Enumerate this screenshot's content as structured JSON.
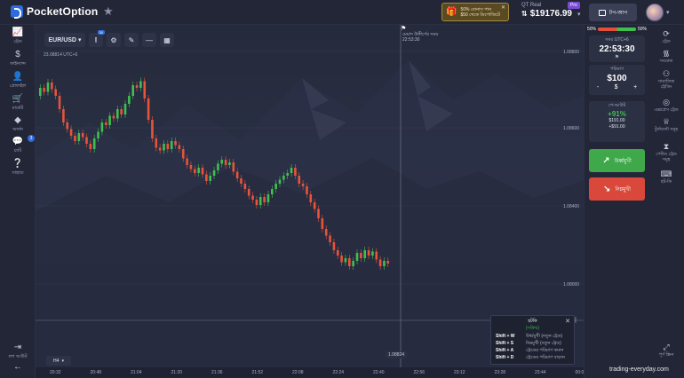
{
  "header": {
    "brand": "PocketOption",
    "promo": {
      "line1": "50% বোনাস পান",
      "line2": "$50 থেকে ডিপোজিটে"
    },
    "account": {
      "label": "QT Real",
      "balance": "$19176.99",
      "pro_badge": "Pro"
    },
    "topup_label": "টপ-আপ"
  },
  "left_nav": [
    {
      "icon": "chart-icon",
      "glyph": "📈",
      "label": "ট্রেড"
    },
    {
      "icon": "dollar-icon",
      "glyph": "$",
      "label": "ফাইন্যান্স"
    },
    {
      "icon": "profile-icon",
      "glyph": "👤",
      "label": "প্রোফাইল"
    },
    {
      "icon": "market-icon",
      "glyph": "🛒",
      "label": "মার্কেট"
    },
    {
      "icon": "diamond-icon",
      "glyph": "◆",
      "label": "অর্জন"
    },
    {
      "icon": "chat-icon",
      "glyph": "💬",
      "label": "চ্যাট",
      "badge": "3"
    },
    {
      "icon": "help-icon",
      "glyph": "?",
      "label": "সাহায্য"
    }
  ],
  "left_bottom": {
    "logout_label": "লগ আউট"
  },
  "chart_toolbar": {
    "pair": "EUR/USD",
    "indicator_badge": "30"
  },
  "chart_sub": "23.08814 UTC+6",
  "chart_overlay": {
    "expiry_label": "মেয়াদ উত্তীর্ণের সময়",
    "expiry_time": "22:53:30",
    "current_price_tag": "58",
    "price_marker": "1.08824",
    "timeframe": "H4"
  },
  "price_axis": [
    "1.08800",
    "1.08600",
    "1.08400",
    "1.08000"
  ],
  "time_axis": [
    "20:32",
    "20:48",
    "21:04",
    "21:20",
    "21:36",
    "21:52",
    "22:08",
    "22:24",
    "22:40",
    "22:56",
    "23:12",
    "23:28",
    "23:44",
    "00:00"
  ],
  "shortcuts": {
    "title": "হটকি",
    "subtitle": "(সক্রিয়)",
    "rows": [
      {
        "key": "Shift + W",
        "desc": "উর্ধ্বমুখী (নতুন ট্রেড)"
      },
      {
        "key": "Shift + S",
        "desc": "নিম্নমুখী (নতুন ট্রেড)"
      },
      {
        "key": "Shift + A",
        "desc": "ট্রেডের পরিমাণ কমান"
      },
      {
        "key": "Shift + D",
        "desc": "ট্রেডের পরিমাণ বাড়ান"
      }
    ]
  },
  "trade_panel": {
    "sentiment": {
      "sell": "50%",
      "buy": "50%",
      "buy_fraction": 0.5
    },
    "time_caption": "সময় UTC+6",
    "time_value": "22:53:30",
    "amount_caption": "পরিমাণ",
    "amount_value": "$100",
    "minus": "-",
    "currency": "$",
    "plus": "+",
    "payout_caption": "পে-আউট",
    "payout_pct": "+91%",
    "payout_amt": "$191.00",
    "profit_amt": "+$91.00",
    "buy_label": "উর্ধ্বমুখী",
    "sell_label": "নিম্নমুখী"
  },
  "right_nav": [
    {
      "icon": "trades-icon",
      "glyph": "⟳",
      "label": "ট্রেড"
    },
    {
      "icon": "signals-icon",
      "glyph": "📡",
      "label": "সংকেত"
    },
    {
      "icon": "social-icon",
      "glyph": "👥",
      "label": "সামাজিক ট্রেডিং"
    },
    {
      "icon": "express-icon",
      "glyph": "◎",
      "label": "এক্সপ্রেস ট্রেড"
    },
    {
      "icon": "tournament-icon",
      "glyph": "🏆",
      "label": "টুর্নামেন্ট সমূহ"
    },
    {
      "icon": "pending-icon",
      "glyph": "⧗",
      "label": "পেন্ডিং ট্রেড সমূহ"
    },
    {
      "icon": "hotkey-icon",
      "glyph": "⌨",
      "label": "হট-কি"
    },
    {
      "icon": "fullscreen-icon",
      "glyph": "⤢",
      "label": "পূর্ণ স্ক্রিন"
    }
  ],
  "watermark": "trading-everyday.com",
  "colors": {
    "up": "#3fbf4f",
    "down": "#e8533a",
    "accent": "#2d6cdf"
  },
  "chart_data": {
    "type": "candlestick",
    "series": [
      [
        0.8,
        0.86
      ],
      [
        0.86,
        0.83
      ],
      [
        0.83,
        0.9
      ],
      [
        0.9,
        0.85
      ],
      [
        0.85,
        0.8
      ],
      [
        0.8,
        0.7
      ],
      [
        0.7,
        0.6
      ],
      [
        0.6,
        0.55
      ],
      [
        0.55,
        0.5
      ],
      [
        0.5,
        0.46
      ],
      [
        0.46,
        0.52
      ],
      [
        0.52,
        0.49
      ],
      [
        0.49,
        0.44
      ],
      [
        0.44,
        0.4
      ],
      [
        0.4,
        0.48
      ],
      [
        0.48,
        0.53
      ],
      [
        0.53,
        0.6
      ],
      [
        0.6,
        0.58
      ],
      [
        0.58,
        0.65
      ],
      [
        0.65,
        0.63
      ],
      [
        0.63,
        0.7
      ],
      [
        0.7,
        0.66
      ],
      [
        0.66,
        0.74
      ],
      [
        0.74,
        0.8
      ],
      [
        0.8,
        0.88
      ],
      [
        0.88,
        0.86
      ],
      [
        0.86,
        0.91
      ],
      [
        0.91,
        0.78
      ],
      [
        0.78,
        0.62
      ],
      [
        0.62,
        0.48
      ],
      [
        0.48,
        0.41
      ],
      [
        0.41,
        0.39
      ],
      [
        0.39,
        0.44
      ],
      [
        0.44,
        0.4
      ],
      [
        0.4,
        0.46
      ],
      [
        0.46,
        0.43
      ],
      [
        0.43,
        0.4
      ],
      [
        0.4,
        0.33
      ],
      [
        0.33,
        0.28
      ],
      [
        0.28,
        0.25
      ],
      [
        0.25,
        0.22
      ],
      [
        0.22,
        0.26
      ],
      [
        0.26,
        0.21
      ],
      [
        0.21,
        0.16
      ],
      [
        0.16,
        0.2
      ],
      [
        0.2,
        0.24
      ],
      [
        0.24,
        0.29
      ],
      [
        0.29,
        0.32
      ],
      [
        0.32,
        0.28
      ],
      [
        0.28,
        0.3
      ],
      [
        0.3,
        0.23
      ],
      [
        0.23,
        0.18
      ],
      [
        0.18,
        0.14
      ],
      [
        0.14,
        0.1
      ],
      [
        0.1,
        0.05
      ],
      [
        0.05,
        0.02
      ],
      [
        0.02,
        -0.02
      ],
      [
        -0.02,
        0.04
      ],
      [
        0.04,
        0.0
      ],
      [
        0.0,
        0.06
      ],
      [
        0.06,
        0.1
      ],
      [
        0.1,
        0.14
      ],
      [
        0.14,
        0.17
      ],
      [
        0.17,
        0.2
      ],
      [
        0.2,
        0.22
      ],
      [
        0.22,
        0.26
      ],
      [
        0.26,
        0.2
      ],
      [
        0.2,
        0.14
      ],
      [
        0.14,
        0.12
      ],
      [
        0.12,
        0.06
      ],
      [
        0.06,
        0.0
      ],
      [
        0.0,
        -0.05
      ],
      [
        -0.05,
        -0.12
      ],
      [
        -0.12,
        -0.2
      ],
      [
        -0.2,
        -0.25
      ],
      [
        -0.25,
        -0.3
      ],
      [
        -0.3,
        -0.36
      ],
      [
        -0.36,
        -0.4
      ],
      [
        -0.4,
        -0.45
      ],
      [
        -0.45,
        -0.42
      ],
      [
        -0.42,
        -0.48
      ],
      [
        -0.48,
        -0.44
      ],
      [
        -0.44,
        -0.38
      ],
      [
        -0.38,
        -0.42
      ],
      [
        -0.42,
        -0.36
      ],
      [
        -0.36,
        -0.4
      ],
      [
        -0.4,
        -0.37
      ],
      [
        -0.37,
        -0.43
      ],
      [
        -0.43,
        -0.48
      ],
      [
        -0.48,
        -0.44
      ],
      [
        -0.44,
        -0.46
      ]
    ]
  }
}
